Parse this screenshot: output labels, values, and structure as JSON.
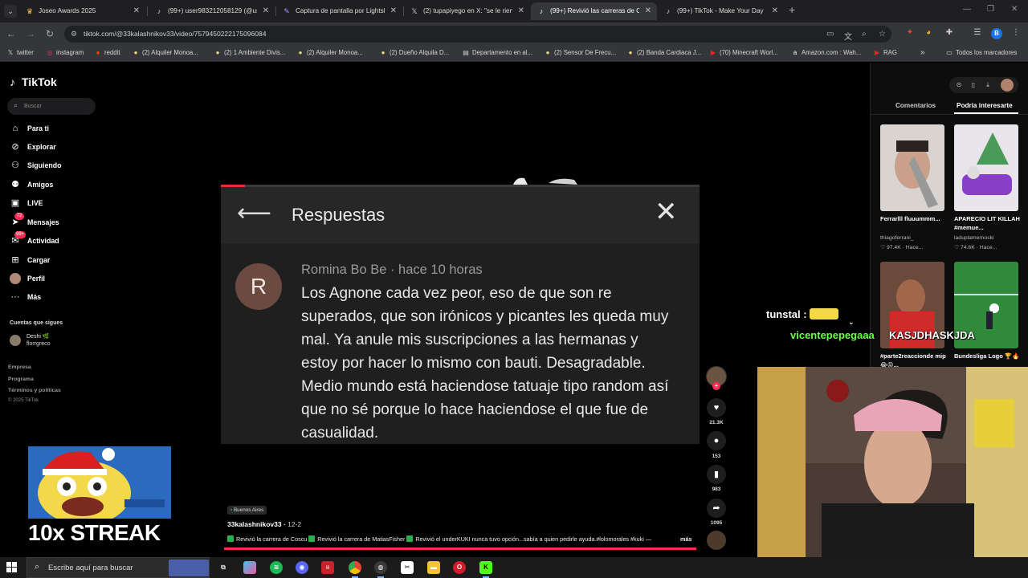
{
  "browser": {
    "tabs": [
      {
        "title": "Joseo Awards 2025",
        "icon": "crown-icon",
        "active": false
      },
      {
        "title": "(99+) user983212058129 (@use",
        "icon": "tiktok-icon",
        "active": false
      },
      {
        "title": "Captura de pantalla por Lightsh",
        "icon": "feather-icon",
        "active": false
      },
      {
        "title": "(2) tupapiyego en X: \"se le rien",
        "icon": "x-icon",
        "active": false
      },
      {
        "title": "(99+) Revivió las carreras de Co",
        "icon": "tiktok-icon",
        "active": true
      },
      {
        "title": "(99+) TikTok - Make Your Day",
        "icon": "tiktok-icon",
        "active": false
      }
    ],
    "url": "tiktok.com/@33kalashnikov33/video/7579450222175096084",
    "profile_initial": "B",
    "bookmarks": [
      {
        "label": "twitter",
        "icon": "x-icon"
      },
      {
        "label": "instagram",
        "icon": "instagram-icon"
      },
      {
        "label": "reddit",
        "icon": "reddit-icon"
      },
      {
        "label": "(2) Alquiler Monoa...",
        "icon": "listing-icon"
      },
      {
        "label": "(2) 1 Ambiente Divis...",
        "icon": "listing-icon"
      },
      {
        "label": "(2) Alquiler Monoa...",
        "icon": "listing-icon"
      },
      {
        "label": "(2) Dueño Alquila D...",
        "icon": "listing-icon"
      },
      {
        "label": "Departamento en al...",
        "icon": "listing-icon"
      },
      {
        "label": "(2) Sensor De Frecu...",
        "icon": "listing-icon"
      },
      {
        "label": "(2) Banda Cardiaca J...",
        "icon": "listing-icon"
      },
      {
        "label": "(70) Minecraft Worl...",
        "icon": "youtube-icon"
      },
      {
        "label": "Amazon.com : Wah...",
        "icon": "amazon-icon"
      },
      {
        "label": "RAG",
        "icon": "youtube-icon"
      }
    ],
    "bookmarks_overflow": "»",
    "all_bookmarks": "Todos los marcadores"
  },
  "tiktok": {
    "logo": "TikTok",
    "search_placeholder": "Buscar",
    "nav": [
      {
        "label": "Para ti",
        "icon": "home-icon"
      },
      {
        "label": "Explorar",
        "icon": "compass-icon"
      },
      {
        "label": "Siguiendo",
        "icon": "following-icon"
      },
      {
        "label": "Amigos",
        "icon": "friends-icon"
      },
      {
        "label": "LIVE",
        "icon": "live-icon"
      },
      {
        "label": "Mensajes",
        "icon": "messages-icon",
        "badge": "72"
      },
      {
        "label": "Actividad",
        "icon": "activity-icon",
        "badge": "99+"
      },
      {
        "label": "Cargar",
        "icon": "upload-icon"
      },
      {
        "label": "Perfil",
        "icon": "profile-icon"
      },
      {
        "label": "Más",
        "icon": "more-icon"
      }
    ],
    "following_title": "Cuentas que sigues",
    "following": [
      {
        "name": "Deshi 🌿",
        "handle": "florrgreco"
      }
    ],
    "footer": [
      "Empresa",
      "Programa",
      "Términos y políticas"
    ],
    "copyright": "© 2025 TikTok"
  },
  "streak": {
    "text": "10x STREAK"
  },
  "reply_panel": {
    "title": "Respuestas",
    "avatar_letter": "R",
    "author": "Romina Bo Be · hace 10 horas",
    "body": "Los Agnone cada vez peor, eso de que son re superados, que son irónicos y picantes les queda muy mal. Ya anule mis suscripciones a las hermanas y estoy por hacer lo mismo con bauti. Desagradable. Medio mundo está haciendose tatuaje tipo random así que no sé porque lo hace haciendose el que fue de casualidad.",
    "video_progress": 0.05
  },
  "actions": {
    "likes": "21.3K",
    "comments": "153",
    "saves": "983",
    "shares": "1095"
  },
  "caption": {
    "location": "Buenos Aires",
    "author": "33kalashnikov33",
    "date": "12-2",
    "segments": [
      "Revivió la carrera de Coscu",
      "Revivió la carrera de MatiasFisher",
      "Revivió el underKUKI nunca tuvo opción...sabía a quien pedirle ayuda.#lolomorales #kuki —"
    ],
    "more": "más",
    "progress": 1.0
  },
  "right_panel": {
    "tabs": [
      "Comentarios",
      "Podría interesarte"
    ],
    "active_tab": 1,
    "cards": [
      {
        "title": "Ferrarlll fluuummm...",
        "author": "thiagoferrani_",
        "stats": "♡ 97.4K · Hace..."
      },
      {
        "title": "APARECIO LIT KILLAH #memue...",
        "author": "laduplamernoski",
        "stats": "♡ 74.6K · Hace..."
      },
      {
        "title": "#parte2reaccionde mip😂😝...",
        "author": "",
        "stats": ""
      },
      {
        "title": "Bundesliga Logo 🏆🔥",
        "author": "",
        "stats": ""
      }
    ]
  },
  "chat": [
    {
      "user": "tunstal :",
      "text": "",
      "color": "#ffffff"
    },
    {
      "user": "",
      "text": "KASJDHASKJDA",
      "color": "#ffffff"
    },
    {
      "user": "vicentepepegaaa",
      "text": "",
      "color": "#6cff4a"
    }
  ],
  "taskbar": {
    "search_placeholder": "Escribe aquí para buscar"
  }
}
